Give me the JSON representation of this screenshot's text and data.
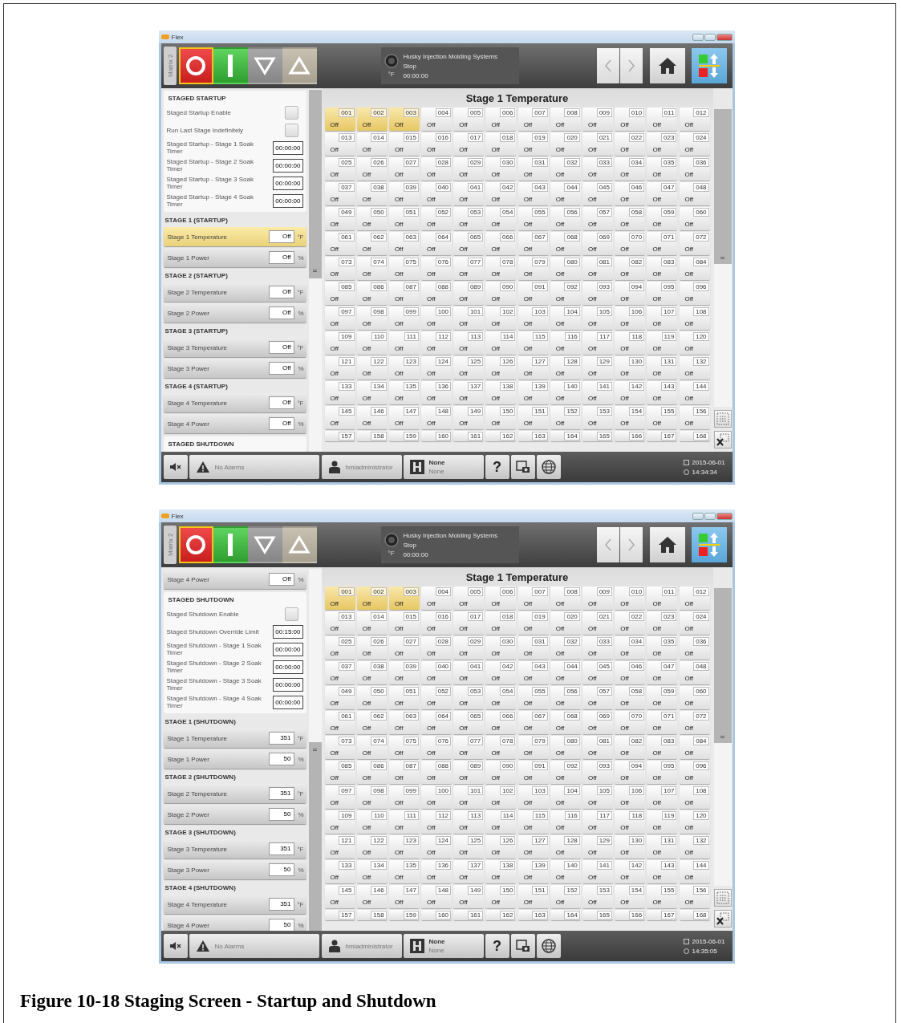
{
  "screens": [
    {
      "window": {
        "title": "Flex"
      },
      "toolbar": {
        "matrix_tab": "Matrix 2",
        "mode_buttons": [
          {
            "kind": "stop",
            "selected": true
          },
          {
            "kind": "start",
            "selected": false
          },
          {
            "kind": "lower",
            "selected": false
          },
          {
            "kind": "raise",
            "selected": false
          }
        ],
        "status": {
          "unit": "°F",
          "system": "Husky Injection Molding Systems",
          "state": "Stop",
          "timer": "00:00:00"
        }
      },
      "side_panel": [
        {
          "title": "STAGED STARTUP",
          "kind": "settings",
          "rows": [
            {
              "label": "Staged Startup Enable",
              "kind": "checkbox",
              "checked": false
            },
            {
              "label": "Run Last Stage Indefinitely",
              "kind": "checkbox",
              "checked": false
            },
            {
              "label": "Staged Startup - Stage 1 Soak Timer",
              "kind": "time",
              "value": "00:00:00"
            },
            {
              "label": "Staged Startup - Stage 2 Soak Timer",
              "kind": "time",
              "value": "00:00:00"
            },
            {
              "label": "Staged Startup - Stage 3 Soak Timer",
              "kind": "time",
              "value": "00:00:00"
            },
            {
              "label": "Staged Startup - Stage 4 Soak Timer",
              "kind": "time",
              "value": "00:00:00"
            }
          ]
        },
        {
          "title": "STAGE 1 (STARTUP)",
          "kind": "stage",
          "rows": [
            {
              "label": "Stage 1 Temperature",
              "value": "Off",
              "unit": "°F",
              "selected": true
            },
            {
              "label": "Stage 1 Power",
              "value": "Off",
              "unit": "%",
              "selected": false
            }
          ]
        },
        {
          "title": "STAGE 2 (STARTUP)",
          "kind": "stage",
          "rows": [
            {
              "label": "Stage 2 Temperature",
              "value": "Off",
              "unit": "°F",
              "selected": false
            },
            {
              "label": "Stage 2 Power",
              "value": "Off",
              "unit": "%",
              "selected": false
            }
          ]
        },
        {
          "title": "STAGE 3 (STARTUP)",
          "kind": "stage",
          "rows": [
            {
              "label": "Stage 3 Temperature",
              "value": "Off",
              "unit": "°F",
              "selected": false
            },
            {
              "label": "Stage 3 Power",
              "value": "Off",
              "unit": "%",
              "selected": false
            }
          ]
        },
        {
          "title": "STAGE 4 (STARTUP)",
          "kind": "stage",
          "rows": [
            {
              "label": "Stage 4 Temperature",
              "value": "Off",
              "unit": "°F",
              "selected": false
            },
            {
              "label": "Stage 4 Power",
              "value": "Off",
              "unit": "%",
              "selected": false
            }
          ]
        },
        {
          "title": "STAGED SHUTDOWN",
          "kind": "settings"
        }
      ],
      "grid_title": "Stage 1 Temperature",
      "zones": [
        {
          "n": "001",
          "v": "Off",
          "selected": true
        },
        {
          "n": "002",
          "v": "Off",
          "selected": true
        },
        {
          "n": "003",
          "v": "Off",
          "selected": true
        },
        {
          "n": "004",
          "v": "Off",
          "selected": false
        },
        {
          "n": "005",
          "v": "Off",
          "selected": false
        },
        {
          "n": "006",
          "v": "Off",
          "selected": false
        },
        {
          "n": "007",
          "v": "Off",
          "selected": false
        },
        {
          "n": "008",
          "v": "Off",
          "selected": false
        },
        {
          "n": "009",
          "v": "Off",
          "selected": false
        },
        {
          "n": "010",
          "v": "Off",
          "selected": false
        },
        {
          "n": "011",
          "v": "Off",
          "selected": false
        },
        {
          "n": "012",
          "v": "Off",
          "selected": false
        },
        {
          "n": "013",
          "v": "Off",
          "selected": false
        },
        {
          "n": "014",
          "v": "Off",
          "selected": false
        },
        {
          "n": "015",
          "v": "Off",
          "selected": false
        },
        {
          "n": "016",
          "v": "Off",
          "selected": false
        },
        {
          "n": "017",
          "v": "Off",
          "selected": false
        },
        {
          "n": "018",
          "v": "Off",
          "selected": false
        },
        {
          "n": "019",
          "v": "Off",
          "selected": false
        },
        {
          "n": "020",
          "v": "Off",
          "selected": false
        },
        {
          "n": "021",
          "v": "Off",
          "selected": false
        },
        {
          "n": "022",
          "v": "Off",
          "selected": false
        },
        {
          "n": "023",
          "v": "Off",
          "selected": false
        },
        {
          "n": "024",
          "v": "Off",
          "selected": false
        },
        {
          "n": "025",
          "v": "Off",
          "selected": false
        },
        {
          "n": "026",
          "v": "Off",
          "selected": false
        },
        {
          "n": "027",
          "v": "Off",
          "selected": false
        },
        {
          "n": "028",
          "v": "Off",
          "selected": false
        },
        {
          "n": "029",
          "v": "Off",
          "selected": false
        },
        {
          "n": "030",
          "v": "Off",
          "selected": false
        },
        {
          "n": "031",
          "v": "Off",
          "selected": false
        },
        {
          "n": "032",
          "v": "Off",
          "selected": false
        },
        {
          "n": "033",
          "v": "Off",
          "selected": false
        },
        {
          "n": "034",
          "v": "Off",
          "selected": false
        },
        {
          "n": "035",
          "v": "Off",
          "selected": false
        },
        {
          "n": "036",
          "v": "Off",
          "selected": false
        },
        {
          "n": "037",
          "v": "Off",
          "selected": false
        },
        {
          "n": "038",
          "v": "Off",
          "selected": false
        },
        {
          "n": "039",
          "v": "Off",
          "selected": false
        },
        {
          "n": "040",
          "v": "Off",
          "selected": false
        },
        {
          "n": "041",
          "v": "Off",
          "selected": false
        },
        {
          "n": "042",
          "v": "Off",
          "selected": false
        },
        {
          "n": "043",
          "v": "Off",
          "selected": false
        },
        {
          "n": "044",
          "v": "Off",
          "selected": false
        },
        {
          "n": "045",
          "v": "Off",
          "selected": false
        },
        {
          "n": "046",
          "v": "Off",
          "selected": false
        },
        {
          "n": "047",
          "v": "Off",
          "selected": false
        },
        {
          "n": "048",
          "v": "Off",
          "selected": false
        },
        {
          "n": "049",
          "v": "Off",
          "selected": false
        },
        {
          "n": "050",
          "v": "Off",
          "selected": false
        },
        {
          "n": "051",
          "v": "Off",
          "selected": false
        },
        {
          "n": "052",
          "v": "Off",
          "selected": false
        },
        {
          "n": "053",
          "v": "Off",
          "selected": false
        },
        {
          "n": "054",
          "v": "Off",
          "selected": false
        },
        {
          "n": "055",
          "v": "Off",
          "selected": false
        },
        {
          "n": "056",
          "v": "Off",
          "selected": false
        },
        {
          "n": "057",
          "v": "Off",
          "selected": false
        },
        {
          "n": "058",
          "v": "Off",
          "selected": false
        },
        {
          "n": "059",
          "v": "Off",
          "selected": false
        },
        {
          "n": "060",
          "v": "Off",
          "selected": false
        },
        {
          "n": "061",
          "v": "Off",
          "selected": false
        },
        {
          "n": "062",
          "v": "Off",
          "selected": false
        },
        {
          "n": "063",
          "v": "Off",
          "selected": false
        },
        {
          "n": "064",
          "v": "Off",
          "selected": false
        },
        {
          "n": "065",
          "v": "Off",
          "selected": false
        },
        {
          "n": "066",
          "v": "Off",
          "selected": false
        },
        {
          "n": "067",
          "v": "Off",
          "selected": false
        },
        {
          "n": "068",
          "v": "Off",
          "selected": false
        },
        {
          "n": "069",
          "v": "Off",
          "selected": false
        },
        {
          "n": "070",
          "v": "Off",
          "selected": false
        },
        {
          "n": "071",
          "v": "Off",
          "selected": false
        },
        {
          "n": "072",
          "v": "Off",
          "selected": false
        },
        {
          "n": "073",
          "v": "Off",
          "selected": false
        },
        {
          "n": "074",
          "v": "Off",
          "selected": false
        },
        {
          "n": "075",
          "v": "Off",
          "selected": false
        },
        {
          "n": "076",
          "v": "Off",
          "selected": false
        },
        {
          "n": "077",
          "v": "Off",
          "selected": false
        },
        {
          "n": "078",
          "v": "Off",
          "selected": false
        },
        {
          "n": "079",
          "v": "Off",
          "selected": false
        },
        {
          "n": "080",
          "v": "Off",
          "selected": false
        },
        {
          "n": "081",
          "v": "Off",
          "selected": false
        },
        {
          "n": "082",
          "v": "Off",
          "selected": false
        },
        {
          "n": "083",
          "v": "Off",
          "selected": false
        },
        {
          "n": "084",
          "v": "Off",
          "selected": false
        },
        {
          "n": "085",
          "v": "Off",
          "selected": false
        },
        {
          "n": "086",
          "v": "Off",
          "selected": false
        },
        {
          "n": "087",
          "v": "Off",
          "selected": false
        },
        {
          "n": "088",
          "v": "Off",
          "selected": false
        },
        {
          "n": "089",
          "v": "Off",
          "selected": false
        },
        {
          "n": "090",
          "v": "Off",
          "selected": false
        },
        {
          "n": "091",
          "v": "Off",
          "selected": false
        },
        {
          "n": "092",
          "v": "Off",
          "selected": false
        },
        {
          "n": "093",
          "v": "Off",
          "selected": false
        },
        {
          "n": "094",
          "v": "Off",
          "selected": false
        },
        {
          "n": "095",
          "v": "Off",
          "selected": false
        },
        {
          "n": "096",
          "v": "Off",
          "selected": false
        },
        {
          "n": "097",
          "v": "Off",
          "selected": false
        },
        {
          "n": "098",
          "v": "Off",
          "selected": false
        },
        {
          "n": "099",
          "v": "Off",
          "selected": false
        },
        {
          "n": "100",
          "v": "Off",
          "selected": false
        },
        {
          "n": "101",
          "v": "Off",
          "selected": false
        },
        {
          "n": "102",
          "v": "Off",
          "selected": false
        },
        {
          "n": "103",
          "v": "Off",
          "selected": false
        },
        {
          "n": "104",
          "v": "Off",
          "selected": false
        },
        {
          "n": "105",
          "v": "Off",
          "selected": false
        },
        {
          "n": "106",
          "v": "Off",
          "selected": false
        },
        {
          "n": "107",
          "v": "Off",
          "selected": false
        },
        {
          "n": "108",
          "v": "Off",
          "selected": false
        },
        {
          "n": "109",
          "v": "Off",
          "selected": false
        },
        {
          "n": "110",
          "v": "Off",
          "selected": false
        },
        {
          "n": "111",
          "v": "Off",
          "selected": false
        },
        {
          "n": "112",
          "v": "Off",
          "selected": false
        },
        {
          "n": "113",
          "v": "Off",
          "selected": false
        },
        {
          "n": "114",
          "v": "Off",
          "selected": false
        },
        {
          "n": "115",
          "v": "Off",
          "selected": false
        },
        {
          "n": "116",
          "v": "Off",
          "selected": false
        },
        {
          "n": "117",
          "v": "Off",
          "selected": false
        },
        {
          "n": "118",
          "v": "Off",
          "selected": false
        },
        {
          "n": "119",
          "v": "Off",
          "selected": false
        },
        {
          "n": "120",
          "v": "Off",
          "selected": false
        },
        {
          "n": "121",
          "v": "Off",
          "selected": false
        },
        {
          "n": "122",
          "v": "Off",
          "selected": false
        },
        {
          "n": "123",
          "v": "Off",
          "selected": false
        },
        {
          "n": "124",
          "v": "Off",
          "selected": false
        },
        {
          "n": "125",
          "v": "Off",
          "selected": false
        },
        {
          "n": "126",
          "v": "Off",
          "selected": false
        },
        {
          "n": "127",
          "v": "Off",
          "selected": false
        },
        {
          "n": "128",
          "v": "Off",
          "selected": false
        },
        {
          "n": "129",
          "v": "Off",
          "selected": false
        },
        {
          "n": "130",
          "v": "Off",
          "selected": false
        },
        {
          "n": "131",
          "v": "Off",
          "selected": false
        },
        {
          "n": "132",
          "v": "Off",
          "selected": false
        },
        {
          "n": "133",
          "v": "Off",
          "selected": false
        },
        {
          "n": "134",
          "v": "Off",
          "selected": false
        },
        {
          "n": "135",
          "v": "Off",
          "selected": false
        },
        {
          "n": "136",
          "v": "Off",
          "selected": false
        },
        {
          "n": "137",
          "v": "Off",
          "selected": false
        },
        {
          "n": "138",
          "v": "Off",
          "selected": false
        },
        {
          "n": "139",
          "v": "Off",
          "selected": false
        },
        {
          "n": "140",
          "v": "Off",
          "selected": false
        },
        {
          "n": "141",
          "v": "Off",
          "selected": false
        },
        {
          "n": "142",
          "v": "Off",
          "selected": false
        },
        {
          "n": "143",
          "v": "Off",
          "selected": false
        },
        {
          "n": "144",
          "v": "Off",
          "selected": false
        },
        {
          "n": "145",
          "v": "Off",
          "selected": false
        },
        {
          "n": "146",
          "v": "Off",
          "selected": false
        },
        {
          "n": "147",
          "v": "Off",
          "selected": false
        },
        {
          "n": "148",
          "v": "Off",
          "selected": false
        },
        {
          "n": "149",
          "v": "Off",
          "selected": false
        },
        {
          "n": "150",
          "v": "Off",
          "selected": false
        },
        {
          "n": "151",
          "v": "Off",
          "selected": false
        },
        {
          "n": "152",
          "v": "Off",
          "selected": false
        },
        {
          "n": "153",
          "v": "Off",
          "selected": false
        },
        {
          "n": "154",
          "v": "Off",
          "selected": false
        },
        {
          "n": "155",
          "v": "Off",
          "selected": false
        },
        {
          "n": "156",
          "v": "Off",
          "selected": false
        },
        {
          "n": "157",
          "selected": false
        },
        {
          "n": "158",
          "selected": false
        },
        {
          "n": "159",
          "selected": false
        },
        {
          "n": "160",
          "selected": false
        },
        {
          "n": "161",
          "selected": false
        },
        {
          "n": "162",
          "selected": false
        },
        {
          "n": "163",
          "selected": false
        },
        {
          "n": "164",
          "selected": false
        },
        {
          "n": "165",
          "selected": false
        },
        {
          "n": "166",
          "selected": false
        },
        {
          "n": "167",
          "selected": false
        },
        {
          "n": "168",
          "selected": false
        }
      ],
      "status_bar": {
        "alarms": "No Alarms",
        "user": "hmiadministrator",
        "mold_name": "None",
        "mold_id": "None",
        "help": "?",
        "date": "2015-06-01",
        "time": "14:34:34"
      }
    },
    {
      "window": {
        "title": "Flex"
      },
      "toolbar": {
        "matrix_tab": "Matrix 2",
        "mode_buttons": [
          {
            "kind": "stop",
            "selected": true
          },
          {
            "kind": "start",
            "selected": false
          },
          {
            "kind": "lower",
            "selected": false
          },
          {
            "kind": "raise",
            "selected": false
          }
        ],
        "status": {
          "unit": "°F",
          "system": "Husky Injection Molding Systems",
          "state": "Stop",
          "timer": "00:00:00"
        }
      },
      "side_panel": [
        {
          "kind": "stage",
          "rows": [
            {
              "label": "Stage 4 Power",
              "value": "Off",
              "unit": "%",
              "selected": false
            }
          ]
        },
        {
          "title": "STAGED SHUTDOWN",
          "kind": "settings",
          "rows": [
            {
              "label": "Staged Shutdown Enable",
              "kind": "checkbox",
              "checked": false
            },
            {
              "label": "Staged Shutdown Override Limit",
              "kind": "time",
              "value": "00:15:00"
            },
            {
              "label": "Staged Shutdown - Stage 1 Soak Timer",
              "kind": "time",
              "value": "00:00:00"
            },
            {
              "label": "Staged Shutdown - Stage 2 Soak Timer",
              "kind": "time",
              "value": "00:00:00"
            },
            {
              "label": "Staged Shutdown - Stage 3 Soak Timer",
              "kind": "time",
              "value": "00:00:00"
            },
            {
              "label": "Staged Shutdown - Stage 4 Soak Timer",
              "kind": "time",
              "value": "00:00:00"
            }
          ]
        },
        {
          "title": "STAGE 1 (SHUTDOWN)",
          "kind": "stage",
          "rows": [
            {
              "label": "Stage 1 Temperature",
              "value": "351",
              "unit": "°F",
              "selected": false
            },
            {
              "label": "Stage 1 Power",
              "value": "50",
              "unit": "%",
              "selected": false
            }
          ]
        },
        {
          "title": "STAGE 2 (SHUTDOWN)",
          "kind": "stage",
          "rows": [
            {
              "label": "Stage 2 Temperature",
              "value": "351",
              "unit": "°F",
              "selected": false
            },
            {
              "label": "Stage 2 Power",
              "value": "50",
              "unit": "%",
              "selected": false
            }
          ]
        },
        {
          "title": "STAGE 3 (SHUTDOWN)",
          "kind": "stage",
          "rows": [
            {
              "label": "Stage 3 Temperature",
              "value": "351",
              "unit": "°F",
              "selected": false
            },
            {
              "label": "Stage 3 Power",
              "value": "50",
              "unit": "%",
              "selected": false
            }
          ]
        },
        {
          "title": "STAGE 4 (SHUTDOWN)",
          "kind": "stage",
          "rows": [
            {
              "label": "Stage 4 Temperature",
              "value": "351",
              "unit": "°F",
              "selected": false
            },
            {
              "label": "Stage 4 Power",
              "value": "50",
              "unit": "%",
              "selected": false
            }
          ]
        }
      ],
      "grid_title": "Stage 1 Temperature",
      "zones": [
        {
          "n": "001",
          "v": "Off",
          "selected": true
        },
        {
          "n": "002",
          "v": "Off",
          "selected": true
        },
        {
          "n": "003",
          "v": "Off",
          "selected": true
        },
        {
          "n": "004",
          "v": "Off",
          "selected": false
        },
        {
          "n": "005",
          "v": "Off",
          "selected": false
        },
        {
          "n": "006",
          "v": "Off",
          "selected": false
        },
        {
          "n": "007",
          "v": "Off",
          "selected": false
        },
        {
          "n": "008",
          "v": "Off",
          "selected": false
        },
        {
          "n": "009",
          "v": "Off",
          "selected": false
        },
        {
          "n": "010",
          "v": "Off",
          "selected": false
        },
        {
          "n": "011",
          "v": "Off",
          "selected": false
        },
        {
          "n": "012",
          "v": "Off",
          "selected": false
        },
        {
          "n": "013",
          "v": "Off",
          "selected": false
        },
        {
          "n": "014",
          "v": "Off",
          "selected": false
        },
        {
          "n": "015",
          "v": "Off",
          "selected": false
        },
        {
          "n": "016",
          "v": "Off",
          "selected": false
        },
        {
          "n": "017",
          "v": "Off",
          "selected": false
        },
        {
          "n": "018",
          "v": "Off",
          "selected": false
        },
        {
          "n": "019",
          "v": "Off",
          "selected": false
        },
        {
          "n": "020",
          "v": "Off",
          "selected": false
        },
        {
          "n": "021",
          "v": "Off",
          "selected": false
        },
        {
          "n": "022",
          "v": "Off",
          "selected": false
        },
        {
          "n": "023",
          "v": "Off",
          "selected": false
        },
        {
          "n": "024",
          "v": "Off",
          "selected": false
        },
        {
          "n": "025",
          "v": "Off",
          "selected": false
        },
        {
          "n": "026",
          "v": "Off",
          "selected": false
        },
        {
          "n": "027",
          "v": "Off",
          "selected": false
        },
        {
          "n": "028",
          "v": "Off",
          "selected": false
        },
        {
          "n": "029",
          "v": "Off",
          "selected": false
        },
        {
          "n": "030",
          "v": "Off",
          "selected": false
        },
        {
          "n": "031",
          "v": "Off",
          "selected": false
        },
        {
          "n": "032",
          "v": "Off",
          "selected": false
        },
        {
          "n": "033",
          "v": "Off",
          "selected": false
        },
        {
          "n": "034",
          "v": "Off",
          "selected": false
        },
        {
          "n": "035",
          "v": "Off",
          "selected": false
        },
        {
          "n": "036",
          "v": "Off",
          "selected": false
        },
        {
          "n": "037",
          "v": "Off",
          "selected": false
        },
        {
          "n": "038",
          "v": "Off",
          "selected": false
        },
        {
          "n": "039",
          "v": "Off",
          "selected": false
        },
        {
          "n": "040",
          "v": "Off",
          "selected": false
        },
        {
          "n": "041",
          "v": "Off",
          "selected": false
        },
        {
          "n": "042",
          "v": "Off",
          "selected": false
        },
        {
          "n": "043",
          "v": "Off",
          "selected": false
        },
        {
          "n": "044",
          "v": "Off",
          "selected": false
        },
        {
          "n": "045",
          "v": "Off",
          "selected": false
        },
        {
          "n": "046",
          "v": "Off",
          "selected": false
        },
        {
          "n": "047",
          "v": "Off",
          "selected": false
        },
        {
          "n": "048",
          "v": "Off",
          "selected": false
        },
        {
          "n": "049",
          "v": "Off",
          "selected": false
        },
        {
          "n": "050",
          "v": "Off",
          "selected": false
        },
        {
          "n": "051",
          "v": "Off",
          "selected": false
        },
        {
          "n": "052",
          "v": "Off",
          "selected": false
        },
        {
          "n": "053",
          "v": "Off",
          "selected": false
        },
        {
          "n": "054",
          "v": "Off",
          "selected": false
        },
        {
          "n": "055",
          "v": "Off",
          "selected": false
        },
        {
          "n": "056",
          "v": "Off",
          "selected": false
        },
        {
          "n": "057",
          "v": "Off",
          "selected": false
        },
        {
          "n": "058",
          "v": "Off",
          "selected": false
        },
        {
          "n": "059",
          "v": "Off",
          "selected": false
        },
        {
          "n": "060",
          "v": "Off",
          "selected": false
        },
        {
          "n": "061",
          "v": "Off",
          "selected": false
        },
        {
          "n": "062",
          "v": "Off",
          "selected": false
        },
        {
          "n": "063",
          "v": "Off",
          "selected": false
        },
        {
          "n": "064",
          "v": "Off",
          "selected": false
        },
        {
          "n": "065",
          "v": "Off",
          "selected": false
        },
        {
          "n": "066",
          "v": "Off",
          "selected": false
        },
        {
          "n": "067",
          "v": "Off",
          "selected": false
        },
        {
          "n": "068",
          "v": "Off",
          "selected": false
        },
        {
          "n": "069",
          "v": "Off",
          "selected": false
        },
        {
          "n": "070",
          "v": "Off",
          "selected": false
        },
        {
          "n": "071",
          "v": "Off",
          "selected": false
        },
        {
          "n": "072",
          "v": "Off",
          "selected": false
        },
        {
          "n": "073",
          "v": "Off",
          "selected": false
        },
        {
          "n": "074",
          "v": "Off",
          "selected": false
        },
        {
          "n": "075",
          "v": "Off",
          "selected": false
        },
        {
          "n": "076",
          "v": "Off",
          "selected": false
        },
        {
          "n": "077",
          "v": "Off",
          "selected": false
        },
        {
          "n": "078",
          "v": "Off",
          "selected": false
        },
        {
          "n": "079",
          "v": "Off",
          "selected": false
        },
        {
          "n": "080",
          "v": "Off",
          "selected": false
        },
        {
          "n": "081",
          "v": "Off",
          "selected": false
        },
        {
          "n": "082",
          "v": "Off",
          "selected": false
        },
        {
          "n": "083",
          "v": "Off",
          "selected": false
        },
        {
          "n": "084",
          "v": "Off",
          "selected": false
        },
        {
          "n": "085",
          "v": "Off",
          "selected": false
        },
        {
          "n": "086",
          "v": "Off",
          "selected": false
        },
        {
          "n": "087",
          "v": "Off",
          "selected": false
        },
        {
          "n": "088",
          "v": "Off",
          "selected": false
        },
        {
          "n": "089",
          "v": "Off",
          "selected": false
        },
        {
          "n": "090",
          "v": "Off",
          "selected": false
        },
        {
          "n": "091",
          "v": "Off",
          "selected": false
        },
        {
          "n": "092",
          "v": "Off",
          "selected": false
        },
        {
          "n": "093",
          "v": "Off",
          "selected": false
        },
        {
          "n": "094",
          "v": "Off",
          "selected": false
        },
        {
          "n": "095",
          "v": "Off",
          "selected": false
        },
        {
          "n": "096",
          "v": "Off",
          "selected": false
        },
        {
          "n": "097",
          "v": "Off",
          "selected": false
        },
        {
          "n": "098",
          "v": "Off",
          "selected": false
        },
        {
          "n": "099",
          "v": "Off",
          "selected": false
        },
        {
          "n": "100",
          "v": "Off",
          "selected": false
        },
        {
          "n": "101",
          "v": "Off",
          "selected": false
        },
        {
          "n": "102",
          "v": "Off",
          "selected": false
        },
        {
          "n": "103",
          "v": "Off",
          "selected": false
        },
        {
          "n": "104",
          "v": "Off",
          "selected": false
        },
        {
          "n": "105",
          "v": "Off",
          "selected": false
        },
        {
          "n": "106",
          "v": "Off",
          "selected": false
        },
        {
          "n": "107",
          "v": "Off",
          "selected": false
        },
        {
          "n": "108",
          "v": "Off",
          "selected": false
        },
        {
          "n": "109",
          "v": "Off",
          "selected": false
        },
        {
          "n": "110",
          "v": "Off",
          "selected": false
        },
        {
          "n": "111",
          "v": "Off",
          "selected": false
        },
        {
          "n": "112",
          "v": "Off",
          "selected": false
        },
        {
          "n": "113",
          "v": "Off",
          "selected": false
        },
        {
          "n": "114",
          "v": "Off",
          "selected": false
        },
        {
          "n": "115",
          "v": "Off",
          "selected": false
        },
        {
          "n": "116",
          "v": "Off",
          "selected": false
        },
        {
          "n": "117",
          "v": "Off",
          "selected": false
        },
        {
          "n": "118",
          "v": "Off",
          "selected": false
        },
        {
          "n": "119",
          "v": "Off",
          "selected": false
        },
        {
          "n": "120",
          "v": "Off",
          "selected": false
        },
        {
          "n": "121",
          "v": "Off",
          "selected": false
        },
        {
          "n": "122",
          "v": "Off",
          "selected": false
        },
        {
          "n": "123",
          "v": "Off",
          "selected": false
        },
        {
          "n": "124",
          "v": "Off",
          "selected": false
        },
        {
          "n": "125",
          "v": "Off",
          "selected": false
        },
        {
          "n": "126",
          "v": "Off",
          "selected": false
        },
        {
          "n": "127",
          "v": "Off",
          "selected": false
        },
        {
          "n": "128",
          "v": "Off",
          "selected": false
        },
        {
          "n": "129",
          "v": "Off",
          "selected": false
        },
        {
          "n": "130",
          "v": "Off",
          "selected": false
        },
        {
          "n": "131",
          "v": "Off",
          "selected": false
        },
        {
          "n": "132",
          "v": "Off",
          "selected": false
        },
        {
          "n": "133",
          "v": "Off",
          "selected": false
        },
        {
          "n": "134",
          "v": "Off",
          "selected": false
        },
        {
          "n": "135",
          "v": "Off",
          "selected": false
        },
        {
          "n": "136",
          "v": "Off",
          "selected": false
        },
        {
          "n": "137",
          "v": "Off",
          "selected": false
        },
        {
          "n": "138",
          "v": "Off",
          "selected": false
        },
        {
          "n": "139",
          "v": "Off",
          "selected": false
        },
        {
          "n": "140",
          "v": "Off",
          "selected": false
        },
        {
          "n": "141",
          "v": "Off",
          "selected": false
        },
        {
          "n": "142",
          "v": "Off",
          "selected": false
        },
        {
          "n": "143",
          "v": "Off",
          "selected": false
        },
        {
          "n": "144",
          "v": "Off",
          "selected": false
        },
        {
          "n": "145",
          "v": "Off",
          "selected": false
        },
        {
          "n": "146",
          "v": "Off",
          "selected": false
        },
        {
          "n": "147",
          "v": "Off",
          "selected": false
        },
        {
          "n": "148",
          "v": "Off",
          "selected": false
        },
        {
          "n": "149",
          "v": "Off",
          "selected": false
        },
        {
          "n": "150",
          "v": "Off",
          "selected": false
        },
        {
          "n": "151",
          "v": "Off",
          "selected": false
        },
        {
          "n": "152",
          "v": "Off",
          "selected": false
        },
        {
          "n": "153",
          "v": "Off",
          "selected": false
        },
        {
          "n": "154",
          "v": "Off",
          "selected": false
        },
        {
          "n": "155",
          "v": "Off",
          "selected": false
        },
        {
          "n": "156",
          "v": "Off",
          "selected": false
        },
        {
          "n": "157",
          "selected": false
        },
        {
          "n": "158",
          "selected": false
        },
        {
          "n": "159",
          "selected": false
        },
        {
          "n": "160",
          "selected": false
        },
        {
          "n": "161",
          "selected": false
        },
        {
          "n": "162",
          "selected": false
        },
        {
          "n": "163",
          "selected": false
        },
        {
          "n": "164",
          "selected": false
        },
        {
          "n": "165",
          "selected": false
        },
        {
          "n": "166",
          "selected": false
        },
        {
          "n": "167",
          "selected": false
        },
        {
          "n": "168",
          "selected": false
        }
      ],
      "status_bar": {
        "alarms": "No Alarms",
        "user": "hmiadministrator",
        "mold_name": "None",
        "mold_id": "None",
        "help": "?",
        "date": "2015-06-01",
        "time": "14:35:05"
      }
    }
  ],
  "caption": "Figure 10-18 Staging Screen - Startup and Shutdown"
}
